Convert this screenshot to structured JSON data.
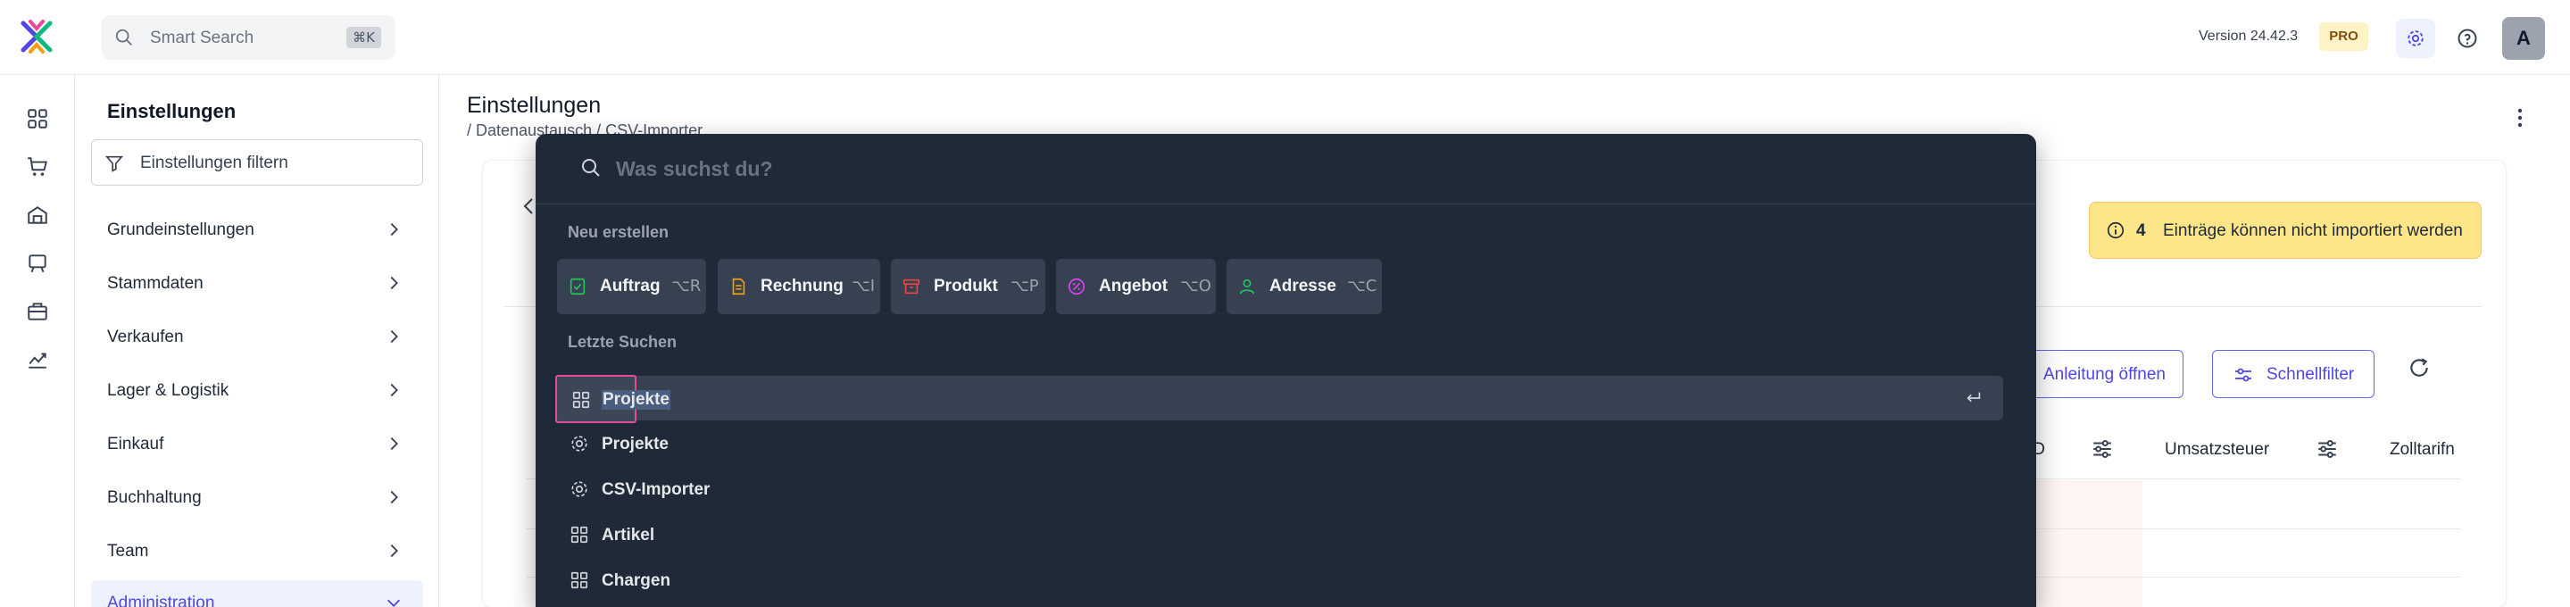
{
  "topbar": {
    "search_placeholder": "Smart Search",
    "search_shortcut": "⌘K",
    "version": "Version 24.42.3",
    "plan_badge": "PRO",
    "avatar_initial": "A"
  },
  "rail": {
    "icons": [
      "dashboard-icon",
      "cart-icon",
      "warehouse-icon",
      "projects-icon",
      "inventory-icon",
      "analytics-icon"
    ]
  },
  "settings": {
    "title": "Einstellungen",
    "filter_placeholder": "Einstellungen filtern",
    "items": [
      {
        "label": "Grundeinstellungen"
      },
      {
        "label": "Stammdaten"
      },
      {
        "label": "Verkaufen"
      },
      {
        "label": "Lager & Logistik"
      },
      {
        "label": "Einkauf"
      },
      {
        "label": "Buchhaltung"
      },
      {
        "label": "Team"
      },
      {
        "label": "Administration"
      }
    ]
  },
  "main": {
    "title": "Einstellungen",
    "breadcrumb": "/ Datenaustausch / CSV-Importer",
    "warning_count": "4",
    "warning_text": "Einträge können nicht importiert werden",
    "guide_button": "Anleitung öffnen",
    "quickfilter_button": "Schnellfilter",
    "columns": [
      "ID",
      "Umsatzsteuer",
      "Zolltarifn"
    ]
  },
  "palette": {
    "search_placeholder": "Was suchst du?",
    "create_heading": "Neu erstellen",
    "create_items": [
      {
        "label": "Auftrag",
        "shortcut": "⌥R",
        "icon": "order-icon",
        "color": "#22c55e"
      },
      {
        "label": "Rechnung",
        "shortcut": "⌥I",
        "icon": "invoice-icon",
        "color": "#f59e0b"
      },
      {
        "label": "Produkt",
        "shortcut": "⌥P",
        "icon": "product-icon",
        "color": "#ef4444"
      },
      {
        "label": "Angebot",
        "shortcut": "⌥O",
        "icon": "offer-icon",
        "color": "#d946ef"
      },
      {
        "label": "Adresse",
        "shortcut": "⌥C",
        "icon": "address-icon",
        "color": "#22c55e"
      }
    ],
    "recent_heading": "Letzte Suchen",
    "recent_items": [
      {
        "label": "Projekte",
        "icon": "grid-icon"
      },
      {
        "label": "Projekte",
        "icon": "gear-icon"
      },
      {
        "label": "CSV-Importer",
        "icon": "gear-icon"
      },
      {
        "label": "Artikel",
        "icon": "grid-icon"
      },
      {
        "label": "Chargen",
        "icon": "grid-icon"
      }
    ]
  },
  "colors": {
    "accent": "#4f46e5",
    "palette_bg": "#1f2937",
    "warning_bg": "#fde68a",
    "selection_border": "#e04d9c"
  }
}
